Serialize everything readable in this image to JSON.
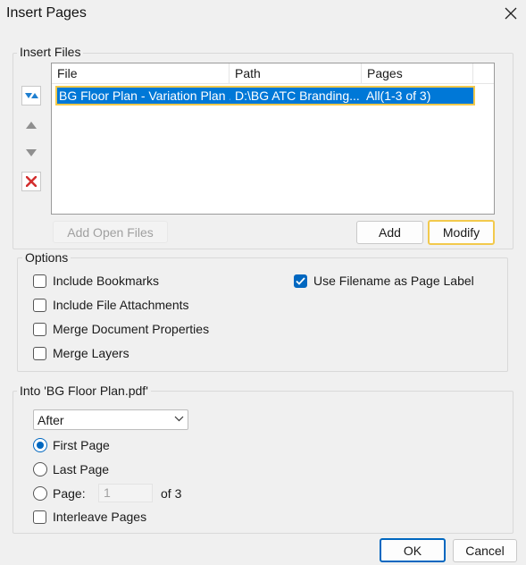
{
  "window": {
    "title": "Insert Pages"
  },
  "insert_files": {
    "group_label": "Insert Files",
    "columns": [
      "File",
      "Path",
      "Pages"
    ],
    "rows": [
      {
        "file": "BG Floor Plan - Variation Plan ...",
        "path": "D:\\BG ATC Branding...",
        "pages": "All(1-3 of 3)"
      }
    ],
    "add_open_files_label": "Add Open Files",
    "add_label": "Add",
    "modify_label": "Modify"
  },
  "options": {
    "group_label": "Options",
    "include_bookmarks": {
      "label": "Include Bookmarks",
      "checked": false
    },
    "include_file_attachments": {
      "label": "Include File Attachments",
      "checked": false
    },
    "merge_document_properties": {
      "label": "Merge Document Properties",
      "checked": false
    },
    "merge_layers": {
      "label": "Merge Layers",
      "checked": false
    },
    "use_filename_as_page_label": {
      "label": "Use Filename as Page Label",
      "checked": true
    }
  },
  "into": {
    "group_label": "Into 'BG Floor Plan.pdf'",
    "position_select": "After",
    "first_page_label": "First Page",
    "last_page_label": "Last Page",
    "page_label": "Page:",
    "page_value": "1",
    "of_label": "of 3",
    "interleave_label": "Interleave Pages",
    "selected_radio": "first_page"
  },
  "footer": {
    "ok_label": "OK",
    "cancel_label": "Cancel"
  },
  "colors": {
    "accent": "#0067c0",
    "selection": "#0078d7",
    "focus_ring": "#f2c94c",
    "delete": "#d32f2f"
  }
}
